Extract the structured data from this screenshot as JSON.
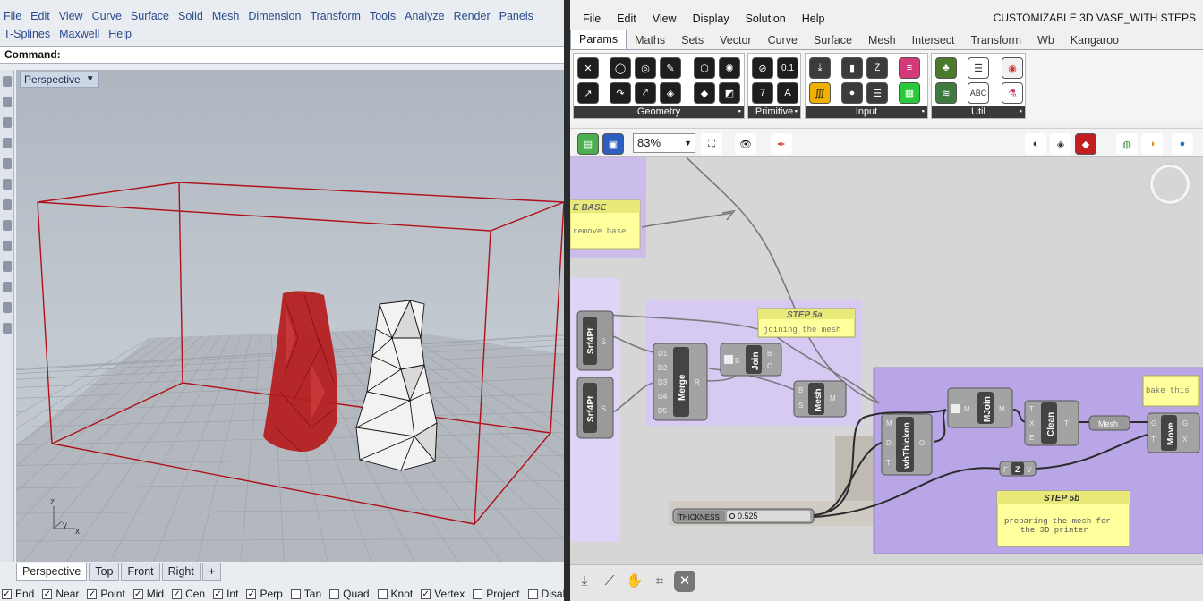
{
  "rhino": {
    "menu_row1": [
      "File",
      "Edit",
      "View",
      "Curve",
      "Surface",
      "Solid",
      "Mesh",
      "Dimension",
      "Transform",
      "Tools",
      "Analyze",
      "Render",
      "Panels"
    ],
    "menu_row2": [
      "T-Splines",
      "Maxwell",
      "Help"
    ],
    "command_label": "Command:",
    "viewport_title": "Perspective",
    "view_tabs": [
      "Perspective",
      "Top",
      "Front",
      "Right"
    ],
    "add_tab_glyph": "+",
    "osnaps": [
      {
        "label": "End",
        "checked": true
      },
      {
        "label": "Near",
        "checked": true
      },
      {
        "label": "Point",
        "checked": true
      },
      {
        "label": "Mid",
        "checked": true
      },
      {
        "label": "Cen",
        "checked": true
      },
      {
        "label": "Int",
        "checked": true
      },
      {
        "label": "Perp",
        "checked": true
      },
      {
        "label": "Tan",
        "checked": false
      },
      {
        "label": "Quad",
        "checked": false
      },
      {
        "label": "Knot",
        "checked": false
      },
      {
        "label": "Vertex",
        "checked": true
      },
      {
        "label": "Project",
        "checked": false
      },
      {
        "label": "Disable",
        "checked": false
      }
    ],
    "axis_labels": {
      "z": "z",
      "y": "y",
      "x": "x"
    },
    "colors": {
      "vase_red": "#b51c1c",
      "bbox_red": "#b0101a",
      "vase_white": "#f2f2f2"
    }
  },
  "grasshopper": {
    "menu": [
      "File",
      "Edit",
      "View",
      "Display",
      "Solution",
      "Help"
    ],
    "title": "CUSTOMIZABLE 3D VASE_WITH STEPS",
    "tabs": [
      "Params",
      "Maths",
      "Sets",
      "Vector",
      "Curve",
      "Surface",
      "Mesh",
      "Intersect",
      "Transform",
      "Wb",
      "Kangaroo"
    ],
    "active_tab": "Params",
    "panels": [
      "Geometry",
      "Primitive",
      "Input",
      "Util"
    ],
    "primitive_glyphs": {
      "int": "0.1",
      "num": "7",
      "txt": "A"
    },
    "zoom": "83%",
    "canvas": {
      "group_base_title": "E BASE",
      "group_base_note": "remove base",
      "step5a_title": "STEP 5a",
      "step5a_note": "joining the mesh",
      "step5b_title": "STEP 5b",
      "step5b_note_line1": "preparing the mesh for",
      "step5b_note_line2": "the 3D printer",
      "bake_note": "bake this",
      "slider_label": "THICKNESS",
      "slider_value": "0.525",
      "components": {
        "srf4pt": "Srf4Pt",
        "merge": "Merge",
        "join": "Join",
        "mesh": "Mesh",
        "mjoin": "MJoin",
        "clean": "Clean",
        "mesh_param": "Mesh",
        "move": "Move",
        "wbthicken": "wbThicken",
        "z": "Z"
      },
      "merge_inputs": [
        "D1",
        "D2",
        "D3",
        "D4",
        "D5"
      ],
      "merge_output": "R",
      "join_inputs": [
        "B"
      ],
      "join_outputs": [
        "B",
        "C"
      ],
      "mesh_inputs": [
        "B",
        "S"
      ],
      "mesh_output": "M",
      "mjoin_input": "M",
      "mjoin_output": "M",
      "clean_inputs": [
        "T",
        "X",
        "E"
      ],
      "clean_output": "T",
      "move_inputs": [
        "G",
        "T"
      ],
      "move_outputs": [
        "G",
        "X"
      ],
      "wb_inputs": [
        "M",
        "D",
        "T"
      ],
      "wb_output": "O",
      "z_input": "F",
      "z_output": "V",
      "srf_output": "S"
    },
    "colors": {
      "group_purple": "#b9a6e6",
      "note_yellow": "#ffff9c",
      "component_grey": "#9a9a9a"
    }
  }
}
